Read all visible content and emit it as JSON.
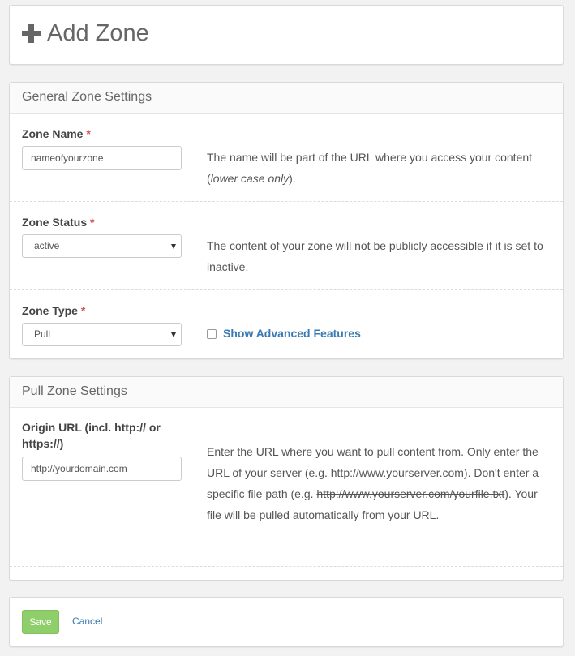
{
  "page": {
    "title": "Add Zone"
  },
  "general": {
    "heading": "General Zone Settings",
    "zone_name": {
      "label": "Zone Name",
      "required": "*",
      "value": "nameofyourzone",
      "help_prefix": "The name will be part of the URL where you access your content (",
      "help_em": "lower case only",
      "help_suffix": ")."
    },
    "zone_status": {
      "label": "Zone Status",
      "required": "*",
      "selected": "active",
      "help": "The content of your zone will not be publicly accessible if it is set to inactive."
    },
    "zone_type": {
      "label": "Zone Type",
      "required": "*",
      "selected": "Pull",
      "advanced_label": "Show Advanced Features"
    }
  },
  "pull": {
    "heading": "Pull Zone Settings",
    "origin": {
      "label": "Origin URL (incl. http:// or https://)",
      "value": "http://yourdomain.com",
      "help_a": "Enter the URL where you want to pull content from. Only enter the URL of your server (e.g. http://www.yourserver.com). Don't enter a specific file path (e.g. ",
      "help_strike": "http://www.yourserver.com/yourfile.txt",
      "help_b": "). Your file will be pulled automatically from your URL."
    }
  },
  "actions": {
    "save_label": "Save",
    "cancel_label": "Cancel"
  },
  "colors": {
    "accent": "#3a7ab2",
    "save": "#8fcf6b",
    "required": "#d9534f"
  }
}
